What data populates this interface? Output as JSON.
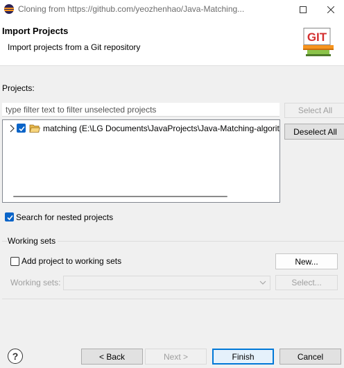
{
  "window": {
    "title": "Cloning from https://github.com/yeozhenhao/Java-Matching..."
  },
  "header": {
    "title": "Import Projects",
    "subtitle": "Import projects from a Git repository",
    "logo_text": "GIT"
  },
  "projects": {
    "label": "Projects:",
    "filter_placeholder": "type filter text to filter unselected projects",
    "select_all_label": "Select All",
    "deselect_all_label": "Deselect All",
    "items": [
      {
        "label": "matching (E:\\LG Documents\\JavaProjects\\Java-Matching-algorit",
        "checked": true
      }
    ]
  },
  "nested": {
    "label": "Search for nested projects",
    "checked": true
  },
  "working_sets": {
    "group_label": "Working sets",
    "add_label": "Add project to working sets",
    "add_checked": false,
    "new_label": "New...",
    "sets_label": "Working sets:",
    "sets_value": "",
    "select_label": "Select..."
  },
  "footer": {
    "back_label": "< Back",
    "next_label": "Next >",
    "finish_label": "Finish",
    "cancel_label": "Cancel"
  },
  "colors": {
    "accent": "#0078d7",
    "checkbox": "#0a64c8",
    "git_red": "#d32f2f",
    "git_orange": "#f7941e"
  }
}
